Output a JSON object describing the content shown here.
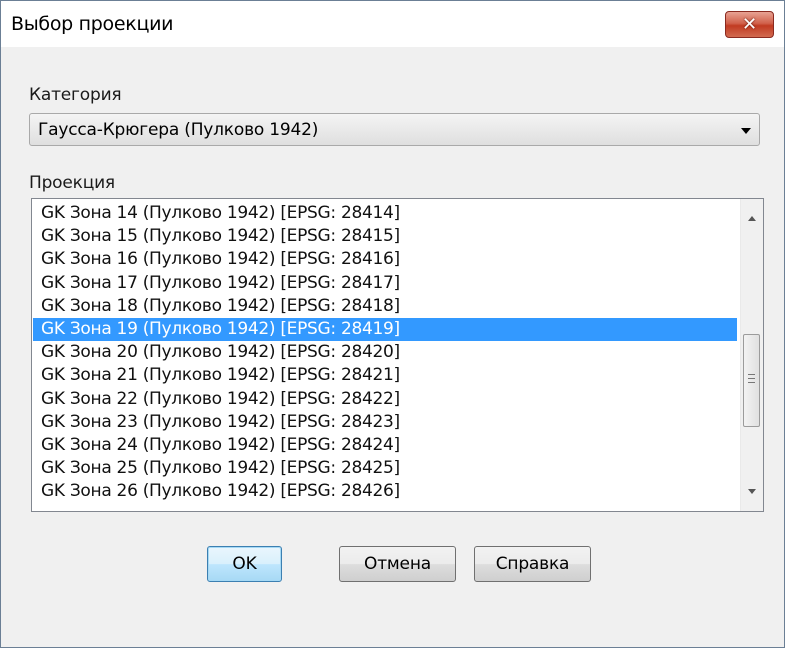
{
  "window": {
    "title": "Выбор проекции",
    "close_glyph": "✕"
  },
  "category": {
    "label": "Категория",
    "selected": "Гаусса-Крюгера (Пулково 1942)"
  },
  "projection": {
    "label": "Проекция",
    "items": [
      "GK Зона 14 (Пулково 1942) [EPSG: 28414]",
      "GK Зона 15 (Пулково 1942) [EPSG: 28415]",
      "GK Зона 16 (Пулково 1942) [EPSG: 28416]",
      "GK Зона 17 (Пулково 1942) [EPSG: 28417]",
      "GK Зона 18 (Пулково 1942) [EPSG: 28418]",
      "GK Зона 19 (Пулково 1942) [EPSG: 28419]",
      "GK Зона 20 (Пулково 1942) [EPSG: 28420]",
      "GK Зона 21 (Пулково 1942) [EPSG: 28421]",
      "GK Зона 22 (Пулково 1942) [EPSG: 28422]",
      "GK Зона 23 (Пулково 1942) [EPSG: 28423]",
      "GK Зона 24 (Пулково 1942) [EPSG: 28424]",
      "GK Зона 25 (Пулково 1942) [EPSG: 28425]",
      "GK Зона 26 (Пулково 1942) [EPSG: 28426]"
    ],
    "selected_index": 5
  },
  "buttons": {
    "ok": "OK",
    "cancel": "Отмена",
    "help": "Справка"
  },
  "colors": {
    "selection": "#3399ff",
    "close_button": "#c13b22"
  }
}
